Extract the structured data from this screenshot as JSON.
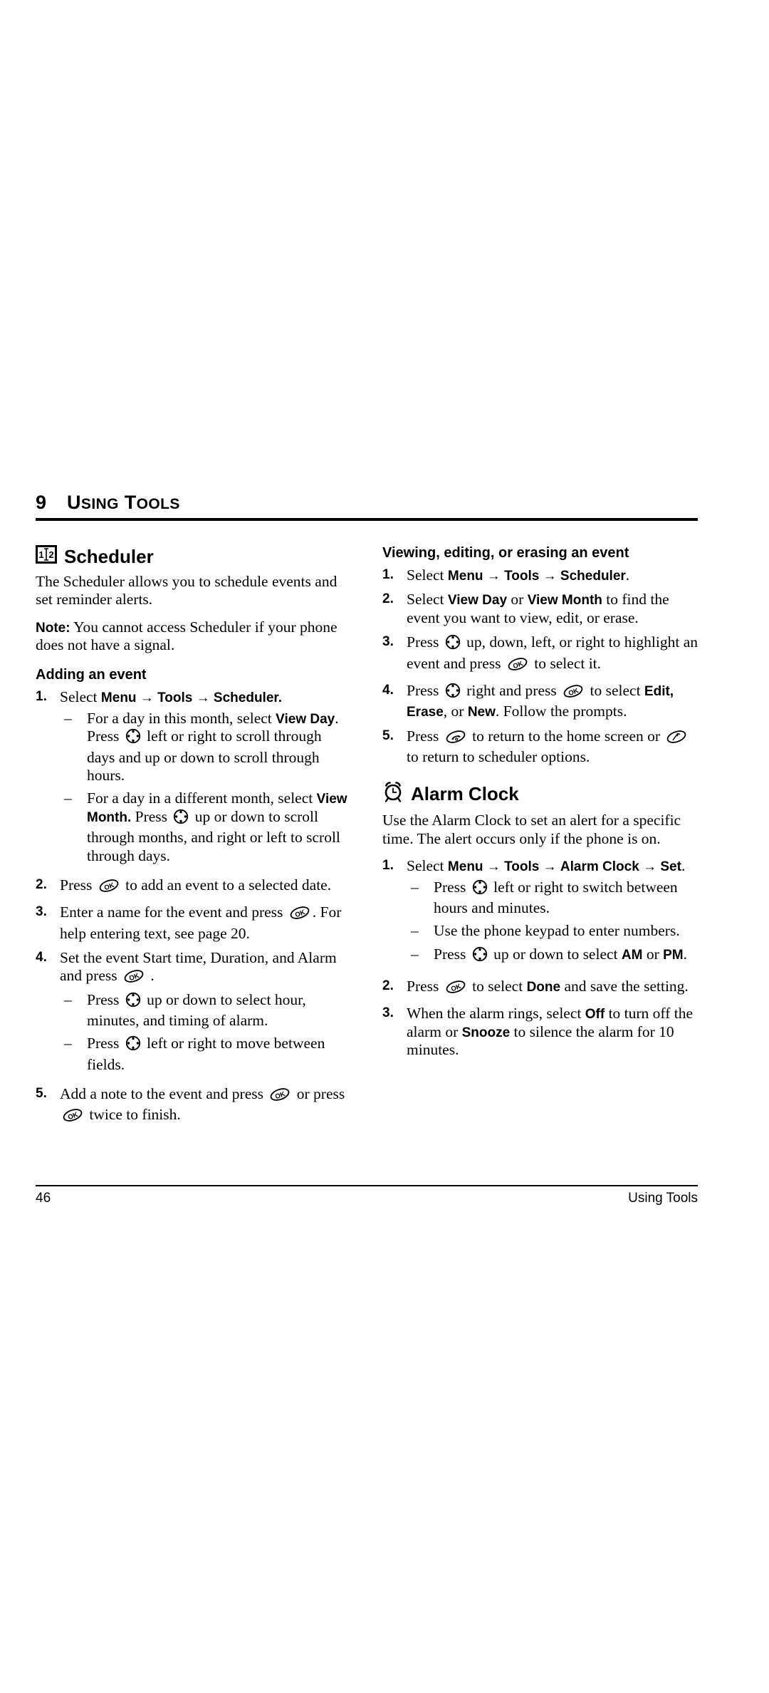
{
  "chapter": {
    "number": "9",
    "title_first": "U",
    "title_rest": "SING",
    "title_first2": "T",
    "title_rest2": "OOLS",
    "title_full": "USING TOOLS"
  },
  "left_column": {
    "scheduler": {
      "icon": "scheduler-calendar-icon",
      "heading": "Scheduler",
      "intro": "The Scheduler allows you to schedule events and set reminder alerts.",
      "note_label": "Note:",
      "note_text": "You cannot access Scheduler if your phone does not have a signal.",
      "subheading": "Adding an event",
      "steps": [
        {
          "num": "1.",
          "parts": [
            {
              "t": "text",
              "v": "Select "
            },
            {
              "t": "bold",
              "v": "Menu"
            },
            {
              "t": "arrow",
              "v": " → "
            },
            {
              "t": "bold",
              "v": "Tools"
            },
            {
              "t": "arrow",
              "v": " → "
            },
            {
              "t": "bold",
              "v": "Scheduler."
            }
          ],
          "sub": [
            {
              "dash": "–",
              "parts": [
                {
                  "t": "text",
                  "v": "For a day in this month, select "
                },
                {
                  "t": "bold",
                  "v": "View Day"
                },
                {
                  "t": "text",
                  "v": ". Press "
                },
                {
                  "t": "icon",
                  "v": "nav-key-icon"
                },
                {
                  "t": "text",
                  "v": " left or right to scroll through days and up or down to scroll through hours."
                }
              ]
            },
            {
              "dash": "–",
              "parts": [
                {
                  "t": "text",
                  "v": "For a day in a different month, select "
                },
                {
                  "t": "bold",
                  "v": "View Month."
                },
                {
                  "t": "text",
                  "v": " Press "
                },
                {
                  "t": "icon",
                  "v": "nav-key-icon"
                },
                {
                  "t": "text",
                  "v": " up or down to scroll through months, and right or left to scroll through days."
                }
              ]
            }
          ]
        },
        {
          "num": "2.",
          "parts": [
            {
              "t": "text",
              "v": "Press "
            },
            {
              "t": "icon",
              "v": "ok-key-icon"
            },
            {
              "t": "text",
              "v": " to add an event to a selected date."
            }
          ],
          "sub": []
        },
        {
          "num": "3.",
          "parts": [
            {
              "t": "text",
              "v": "Enter a name for the event and press "
            },
            {
              "t": "icon",
              "v": "ok-key-icon"
            },
            {
              "t": "text",
              "v": ". For help entering text, see page 20."
            }
          ],
          "sub": []
        },
        {
          "num": "4.",
          "parts": [
            {
              "t": "text",
              "v": "Set the event Start time, Duration, and Alarm and press "
            },
            {
              "t": "icon",
              "v": "ok-key-icon"
            },
            {
              "t": "text",
              "v": " ."
            }
          ],
          "sub": [
            {
              "dash": "–",
              "parts": [
                {
                  "t": "text",
                  "v": "Press "
                },
                {
                  "t": "icon",
                  "v": "nav-key-icon"
                },
                {
                  "t": "text",
                  "v": " up or down to select hour, minutes, and timing of alarm."
                }
              ]
            },
            {
              "dash": "–",
              "parts": [
                {
                  "t": "text",
                  "v": "Press "
                },
                {
                  "t": "icon",
                  "v": "nav-key-icon"
                },
                {
                  "t": "text",
                  "v": " left or right to move between fields."
                }
              ]
            }
          ]
        },
        {
          "num": "5.",
          "parts": [
            {
              "t": "text",
              "v": "Add a note to the event and press "
            },
            {
              "t": "icon",
              "v": "ok-key-icon"
            },
            {
              "t": "text",
              "v": " or press "
            },
            {
              "t": "icon",
              "v": "ok-key-icon"
            },
            {
              "t": "text",
              "v": " twice to finish."
            }
          ],
          "sub": []
        }
      ]
    }
  },
  "right_column": {
    "viewing": {
      "subheading": "Viewing, editing, or erasing an event",
      "steps": [
        {
          "num": "1.",
          "parts": [
            {
              "t": "text",
              "v": "Select "
            },
            {
              "t": "bold",
              "v": "Menu"
            },
            {
              "t": "arrow",
              "v": " → "
            },
            {
              "t": "bold",
              "v": "Tools"
            },
            {
              "t": "arrow",
              "v": " → "
            },
            {
              "t": "bold",
              "v": "Scheduler"
            },
            {
              "t": "text",
              "v": "."
            }
          ],
          "sub": []
        },
        {
          "num": "2.",
          "parts": [
            {
              "t": "text",
              "v": "Select "
            },
            {
              "t": "bold",
              "v": "View Day"
            },
            {
              "t": "text",
              "v": " or "
            },
            {
              "t": "bold",
              "v": "View Month"
            },
            {
              "t": "text",
              "v": " to find the event you want to view, edit, or erase."
            }
          ],
          "sub": []
        },
        {
          "num": "3.",
          "parts": [
            {
              "t": "text",
              "v": "Press "
            },
            {
              "t": "icon",
              "v": "nav-key-icon"
            },
            {
              "t": "text",
              "v": " up, down, left, or right to highlight an event and press "
            },
            {
              "t": "icon",
              "v": "ok-key-icon"
            },
            {
              "t": "text",
              "v": " to select it."
            }
          ],
          "sub": []
        },
        {
          "num": "4.",
          "parts": [
            {
              "t": "text",
              "v": "Press "
            },
            {
              "t": "icon",
              "v": "nav-key-icon"
            },
            {
              "t": "text",
              "v": " right and press "
            },
            {
              "t": "icon",
              "v": "ok-key-icon"
            },
            {
              "t": "text",
              "v": " to select "
            },
            {
              "t": "bold",
              "v": "Edit,"
            },
            {
              "t": "text",
              "v": " "
            },
            {
              "t": "bold",
              "v": "Erase"
            },
            {
              "t": "text",
              "v": ", or "
            },
            {
              "t": "bold",
              "v": "New"
            },
            {
              "t": "text",
              "v": ". Follow the prompts."
            }
          ],
          "sub": []
        },
        {
          "num": "5.",
          "parts": [
            {
              "t": "text",
              "v": "Press "
            },
            {
              "t": "icon",
              "v": "end-call-key-icon"
            },
            {
              "t": "text",
              "v": " to return to the home screen or "
            },
            {
              "t": "icon",
              "v": "back-key-icon"
            },
            {
              "t": "text",
              "v": " to return to scheduler options."
            }
          ],
          "sub": []
        }
      ]
    },
    "alarm": {
      "icon": "alarm-clock-icon",
      "heading": "Alarm Clock",
      "intro": "Use the Alarm Clock to set an alert for a specific time. The alert occurs only if the phone is on.",
      "steps": [
        {
          "num": "1.",
          "parts": [
            {
              "t": "text",
              "v": "Select "
            },
            {
              "t": "bold",
              "v": "Menu"
            },
            {
              "t": "arrow",
              "v": " → "
            },
            {
              "t": "bold",
              "v": "Tools"
            },
            {
              "t": "arrow",
              "v": " → "
            },
            {
              "t": "bold",
              "v": "Alarm Clock"
            },
            {
              "t": "arrow",
              "v": " → "
            },
            {
              "t": "bold",
              "v": "Set"
            },
            {
              "t": "text",
              "v": "."
            }
          ],
          "sub": [
            {
              "dash": "–",
              "parts": [
                {
                  "t": "text",
                  "v": "Press "
                },
                {
                  "t": "icon",
                  "v": "nav-key-icon"
                },
                {
                  "t": "text",
                  "v": " left or right to switch between hours and minutes."
                }
              ]
            },
            {
              "dash": "–",
              "parts": [
                {
                  "t": "text",
                  "v": "Use the phone keypad to enter numbers."
                }
              ]
            },
            {
              "dash": "–",
              "parts": [
                {
                  "t": "text",
                  "v": "Press "
                },
                {
                  "t": "icon",
                  "v": "nav-key-icon"
                },
                {
                  "t": "text",
                  "v": " up or down to select "
                },
                {
                  "t": "bold",
                  "v": "AM"
                },
                {
                  "t": "text",
                  "v": " or "
                },
                {
                  "t": "bold",
                  "v": "PM"
                },
                {
                  "t": "text",
                  "v": "."
                }
              ]
            }
          ]
        },
        {
          "num": "2.",
          "parts": [
            {
              "t": "text",
              "v": "Press "
            },
            {
              "t": "icon",
              "v": "ok-key-icon"
            },
            {
              "t": "text",
              "v": " to select "
            },
            {
              "t": "bold",
              "v": "Done"
            },
            {
              "t": "text",
              "v": " and save the setting."
            }
          ],
          "sub": []
        },
        {
          "num": "3.",
          "parts": [
            {
              "t": "text",
              "v": "When the alarm rings, select "
            },
            {
              "t": "bold",
              "v": "Off"
            },
            {
              "t": "text",
              "v": " to turn off the alarm or "
            },
            {
              "t": "bold",
              "v": "Snooze"
            },
            {
              "t": "text",
              "v": " to silence the alarm for 10 minutes."
            }
          ],
          "sub": []
        }
      ]
    }
  },
  "footer": {
    "page_number": "46",
    "running_title": "Using Tools"
  }
}
